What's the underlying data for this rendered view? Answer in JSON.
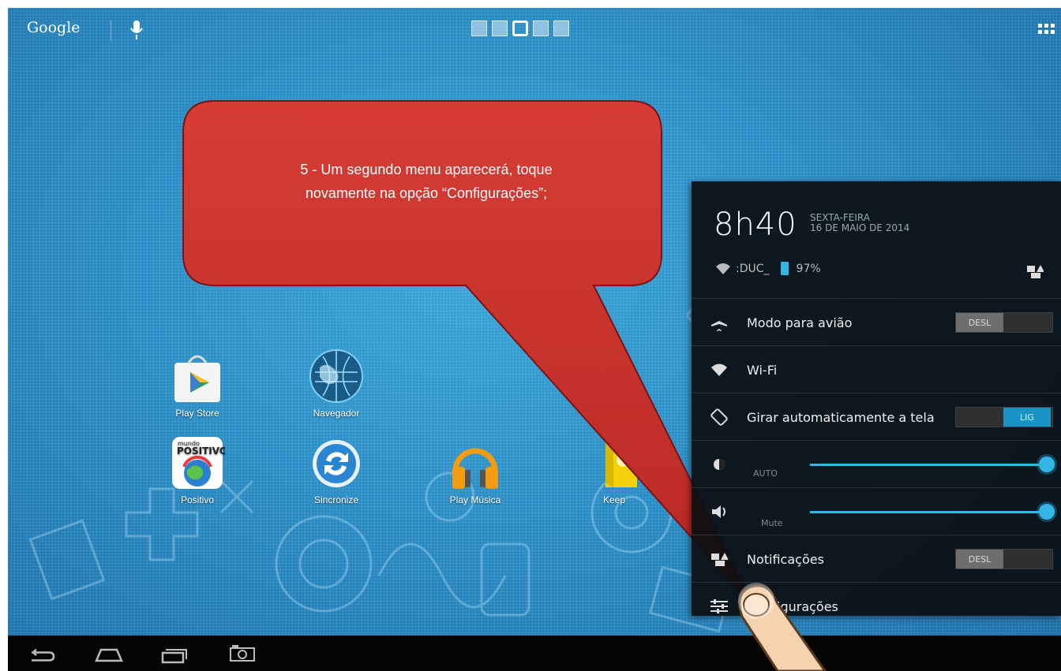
{
  "homescreen": {
    "google_label": "Google",
    "apps": [
      {
        "label": "Play Store"
      },
      {
        "label": "Navegador"
      },
      {
        "label": "Positivo",
        "icon_text": "mundo POSITIVO"
      },
      {
        "label": "Sincronize"
      },
      {
        "label": "Play Música"
      },
      {
        "label": "Keep"
      }
    ]
  },
  "callout": {
    "line1": "5 - Um segundo menu aparecerá, toque",
    "line2": "novamente na opção “Configurações”;"
  },
  "panel": {
    "time": "8h40",
    "weekday": "SEXTA-FEIRA",
    "date": "16 DE MAIO DE 2014",
    "network": ":DUC_",
    "battery": "97%",
    "rows": [
      {
        "label": "Modo para avião",
        "toggle_off": "DESL",
        "toggle_on": ""
      },
      {
        "label": "Wi-Fi"
      },
      {
        "label": "Girar automaticamente a tela",
        "toggle_off": "",
        "toggle_on": "LIG"
      },
      {
        "label": "",
        "slider_label": "AUTO",
        "level": 1.0
      },
      {
        "label": "",
        "slider_label": "Mute",
        "level": 1.0
      },
      {
        "label": "Notificações",
        "toggle_off": "DESL",
        "toggle_on": ""
      },
      {
        "label": "igurações"
      }
    ]
  },
  "colors": {
    "accent": "#33b5e5",
    "callout": "#c8302c",
    "panel_bg": "#0a0e12",
    "wallpaper": "#2a8cc4"
  }
}
